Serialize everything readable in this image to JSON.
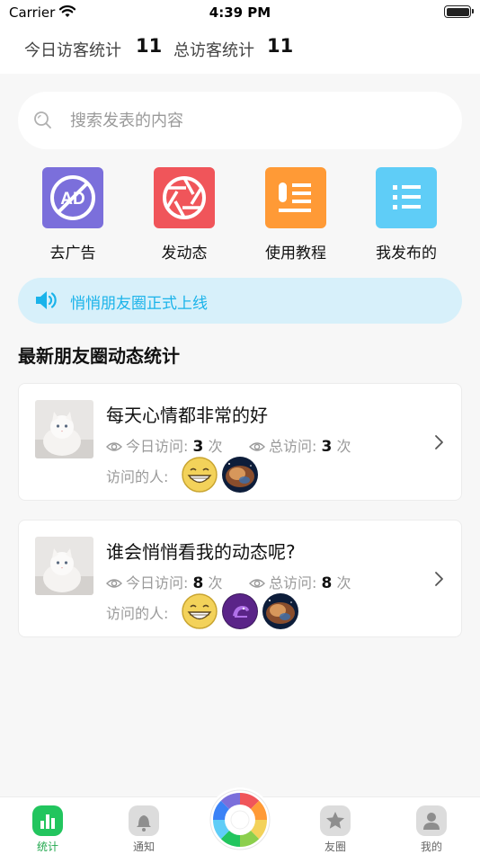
{
  "status_bar": {
    "carrier": "Carrier",
    "time": "4:39 PM"
  },
  "header_stats": {
    "today_label": "今日访客统计",
    "today_value": "11",
    "total_label": "总访客统计",
    "total_value": "11"
  },
  "search": {
    "placeholder": "搜索发表的内容",
    "value": ""
  },
  "features": [
    {
      "label": "去广告",
      "icon": "no-ads-icon",
      "color": "#7b6fdb"
    },
    {
      "label": "发动态",
      "icon": "camera-shutter-icon",
      "color": "#f0555a"
    },
    {
      "label": "使用教程",
      "icon": "tutorial-doc-icon",
      "color": "#ff9a36"
    },
    {
      "label": "我发布的",
      "icon": "list-icon",
      "color": "#5fcdf7"
    }
  ],
  "notice": {
    "text": "悄悄朋友圈正式上线",
    "icon": "speaker-icon"
  },
  "section": {
    "title": "最新朋友圈动态统计"
  },
  "posts": [
    {
      "title": "每天心情都非常的好",
      "today_label": "今日访问:",
      "today_value": "3",
      "today_unit": "次",
      "total_label": "总访问:",
      "total_value": "3",
      "total_unit": "次",
      "visitors_label": "访问的人:",
      "visitor_avatars": [
        "grin-face-avatar",
        "nebula-avatar"
      ]
    },
    {
      "title": "谁会悄悄看我的动态呢?",
      "today_label": "今日访问:",
      "today_value": "8",
      "today_unit": "次",
      "total_label": "总访问:",
      "total_value": "8",
      "total_unit": "次",
      "visitors_label": "访问的人:",
      "visitor_avatars": [
        "grin-face-avatar",
        "purple-bird-avatar",
        "nebula-avatar"
      ]
    }
  ],
  "tabbar": {
    "tabs": [
      {
        "label": "统计",
        "icon": "bar-chart-icon",
        "active": true
      },
      {
        "label": "通知",
        "icon": "bell-icon",
        "active": false
      },
      {
        "label": "",
        "icon": "color-wheel-icon",
        "active": false
      },
      {
        "label": "友圈",
        "icon": "star-icon",
        "active": false
      },
      {
        "label": "我的",
        "icon": "person-icon",
        "active": false
      }
    ]
  },
  "colors": {
    "accent_green": "#22c55e",
    "notice_blue": "#1ab3ea",
    "notice_bg": "#d7f0fa"
  }
}
